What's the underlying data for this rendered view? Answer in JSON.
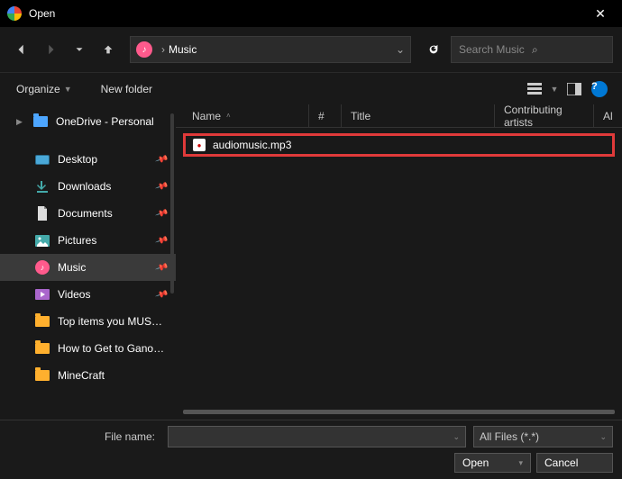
{
  "titlebar": {
    "title": "Open"
  },
  "nav": {
    "breadcrumb": {
      "location": "Music"
    },
    "search_placeholder": "Search Music"
  },
  "toolbar": {
    "organize": "Organize",
    "newfolder": "New folder"
  },
  "sidebar": {
    "onedrive": "OneDrive - Personal",
    "desktop": "Desktop",
    "downloads": "Downloads",
    "documents": "Documents",
    "pictures": "Pictures",
    "music": "Music",
    "videos": "Videos",
    "f1": "Top items you MUST get t",
    "f2": "How to Get to Ganondorf",
    "f3": "MineCraft"
  },
  "columns": {
    "name": "Name",
    "num": "#",
    "title": "Title",
    "artists": "Contributing artists",
    "album": "Al"
  },
  "files": [
    {
      "name": "audiomusic.mp3"
    }
  ],
  "footer": {
    "filename_label": "File name:",
    "filename_value": "",
    "filter": "All Files (*.*)",
    "open": "Open",
    "cancel": "Cancel"
  }
}
